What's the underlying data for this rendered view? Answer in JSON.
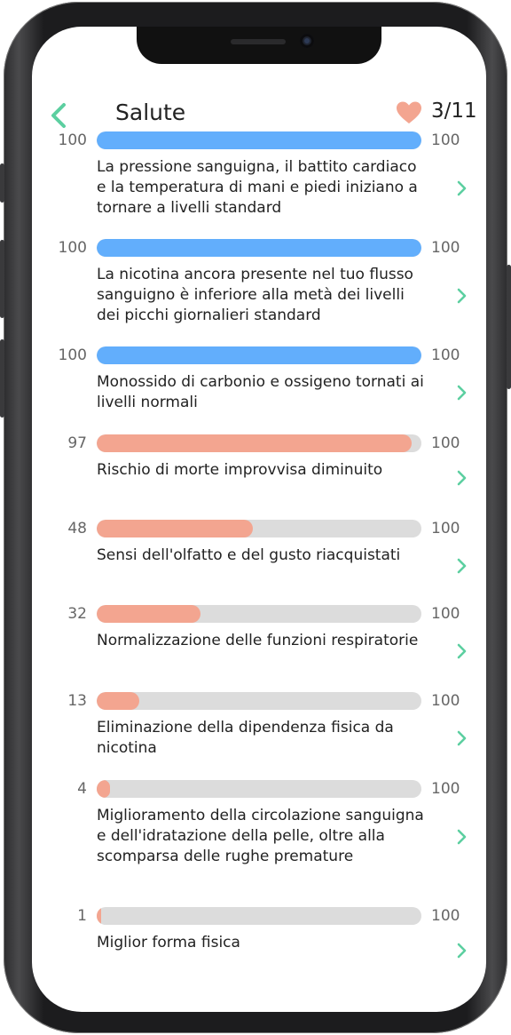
{
  "header": {
    "title": "Salute",
    "counter": "3/11"
  },
  "colors": {
    "accent": "#5ccfa0",
    "blue_bar": "#62aefc",
    "salmon_bar": "#f3a590",
    "heart": "#f3a590",
    "track": "#dcdcdc"
  },
  "items": [
    {
      "value": "100",
      "max": "100",
      "progress": 1.0,
      "color": "blue",
      "text": "La pressione sanguigna, il battito cardiaco e la temperatura di mani e piedi iniziano a tornare a livelli standard"
    },
    {
      "value": "100",
      "max": "100",
      "progress": 1.0,
      "color": "blue",
      "text": "La nicotina ancora presente nel tuo flusso sanguigno è inferiore alla metà dei livelli dei picchi giornalieri standard"
    },
    {
      "value": "100",
      "max": "100",
      "progress": 1.0,
      "color": "blue",
      "text": "Monossido di carbonio e ossigeno tornati ai livelli normali"
    },
    {
      "value": "97",
      "max": "100",
      "progress": 0.97,
      "color": "salmon",
      "text": "Rischio di morte improvvisa diminuito"
    },
    {
      "value": "48",
      "max": "100",
      "progress": 0.48,
      "color": "salmon",
      "text": "Sensi dell'olfatto e del gusto riacquistati"
    },
    {
      "value": "32",
      "max": "100",
      "progress": 0.32,
      "color": "salmon",
      "text": "Normalizzazione delle funzioni respiratorie"
    },
    {
      "value": "13",
      "max": "100",
      "progress": 0.13,
      "color": "salmon",
      "text": "Eliminazione della dipendenza fisica da nicotina"
    },
    {
      "value": "4",
      "max": "100",
      "progress": 0.04,
      "color": "salmon",
      "text": "Miglioramento della circolazione sanguigna e dell'idratazione della pelle, oltre alla scomparsa delle rughe premature"
    },
    {
      "value": "1",
      "max": "100",
      "progress": 0.01,
      "color": "salmon",
      "text": "Miglior forma fisica"
    }
  ]
}
